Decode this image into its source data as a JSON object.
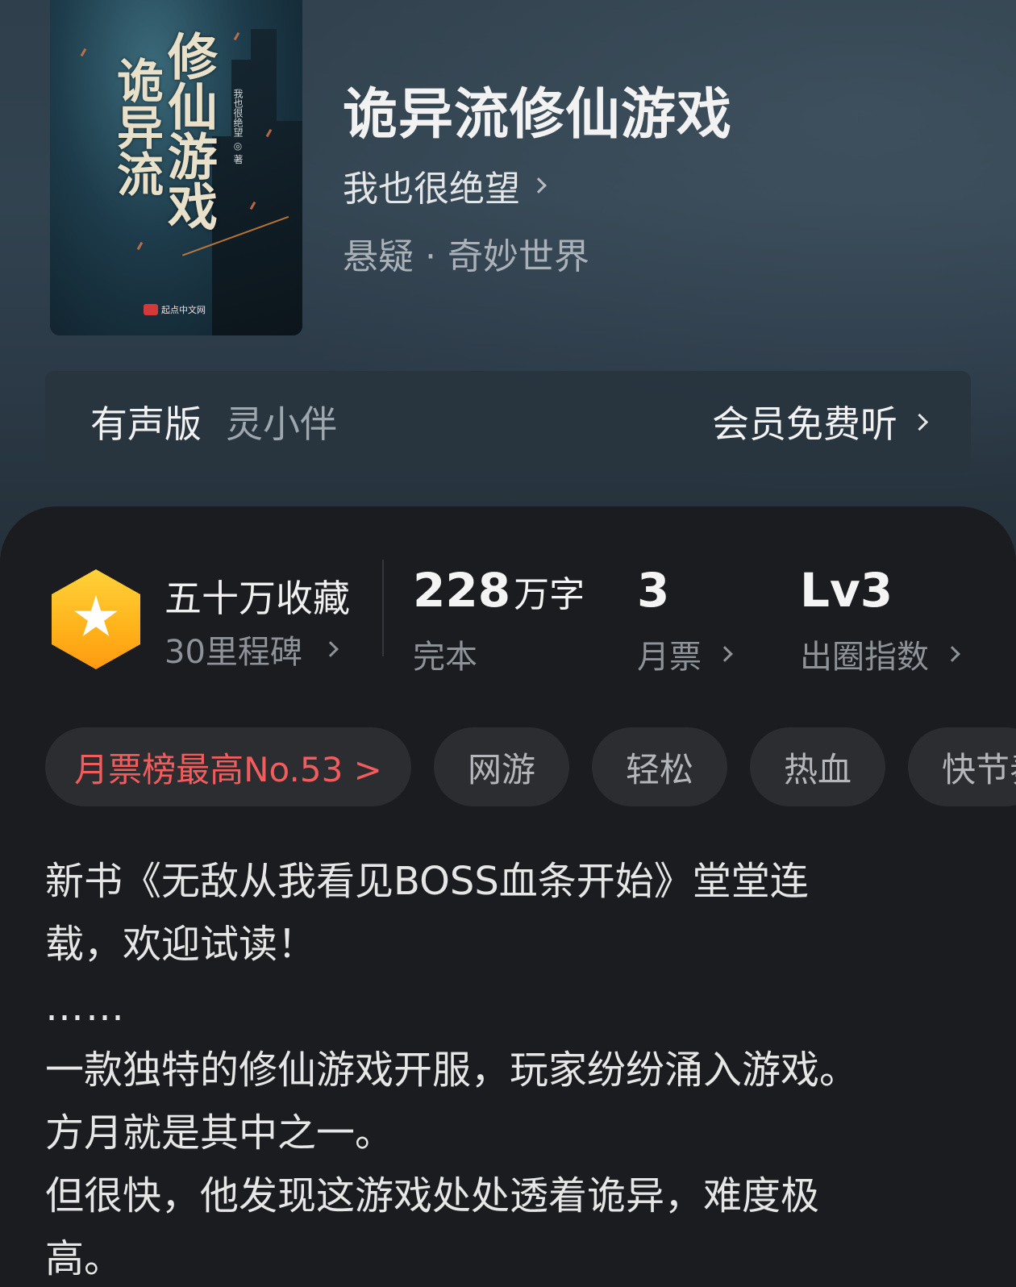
{
  "cover": {
    "title_line1": "修仙游戏",
    "title_line2": "诡异流",
    "author": "我也很绝望 ◎ 著",
    "publisher": "起点中文网"
  },
  "book": {
    "title": "诡异流修仙游戏",
    "author": "我也很绝望",
    "genre": "悬疑 · 奇妙世界"
  },
  "audio": {
    "label": "有声版",
    "narrator": "灵小伴",
    "cta": "会员免费听"
  },
  "stats": {
    "collection": "五十万收藏",
    "milestone": "30里程碑",
    "words_number": "228",
    "words_unit": "万字",
    "status": "完本",
    "monthly_votes": "3",
    "monthly_votes_label": "月票",
    "level": "Lv3",
    "level_label": "出圈指数"
  },
  "tags": {
    "rank": "月票榜最高No.53 >",
    "items": [
      "网游",
      "轻松",
      "热血",
      "快节奏"
    ]
  },
  "description": {
    "lines": [
      "新书《无敌从我看见BOSS血条开始》堂堂连",
      "载，欢迎试读！",
      "……",
      "一款独特的修仙游戏开服，玩家纷纷涌入游戏。",
      "方月就是其中之一。",
      "但很快，他发现这游戏处处透着诡异，难度极",
      "高。"
    ]
  },
  "colors": {
    "header_bg": "#324350",
    "panel_bg": "#1b1c1f",
    "rank_red": "#f25c5c",
    "badge_gold": "#ffb21a"
  }
}
